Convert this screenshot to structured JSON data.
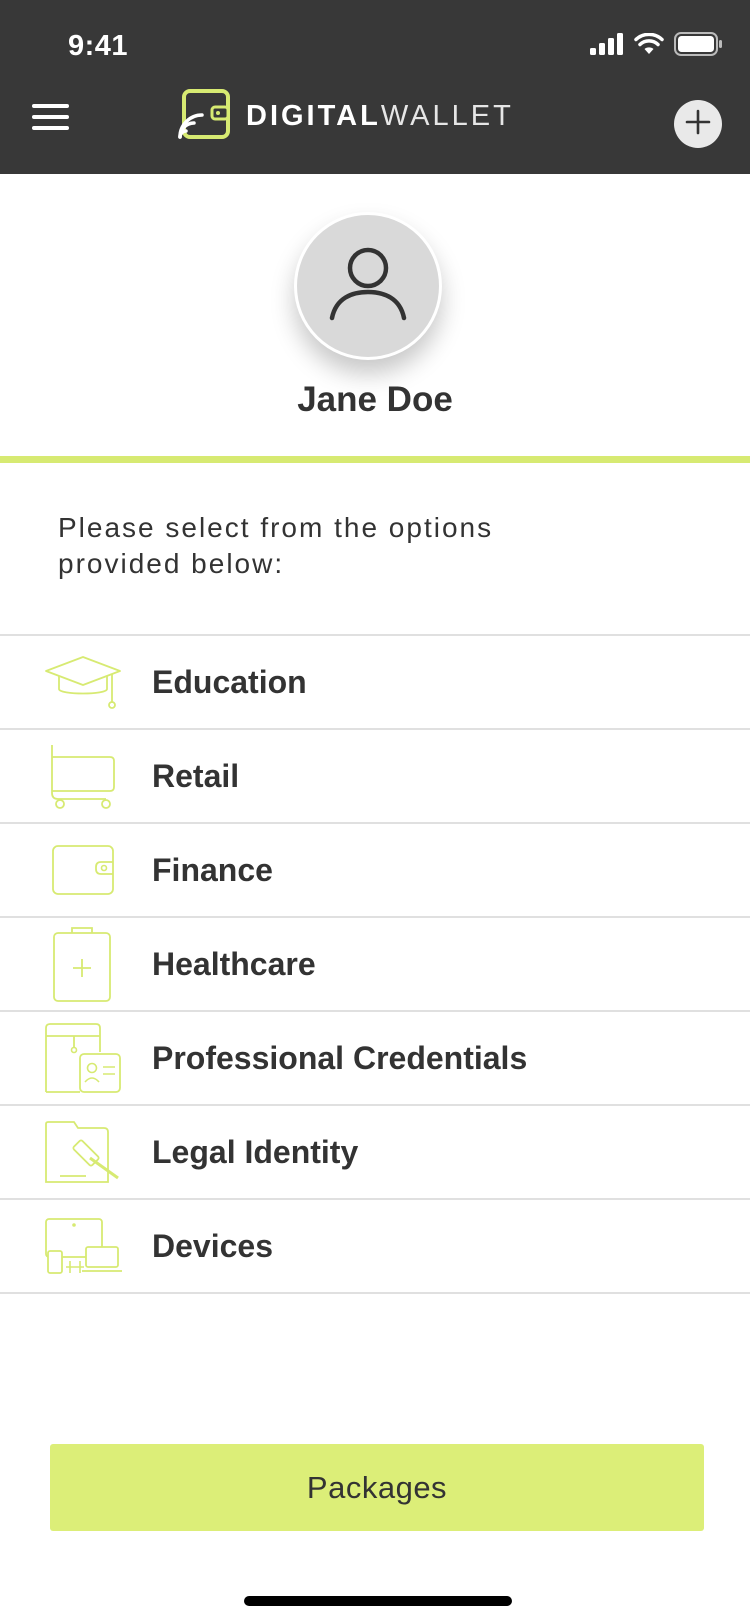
{
  "status_bar": {
    "time": "9:41"
  },
  "header": {
    "logo_bold": "DIGITAL",
    "logo_light": "WALLET",
    "menu_icon": "hamburger-icon",
    "add_icon": "plus-icon"
  },
  "profile": {
    "name": "Jane Doe",
    "avatar_icon": "user-icon"
  },
  "prompt": "Please select from the options provided below:",
  "options": [
    {
      "label": "Education",
      "icon": "graduation-cap-icon"
    },
    {
      "label": "Retail",
      "icon": "shopping-cart-icon"
    },
    {
      "label": "Finance",
      "icon": "wallet-icon"
    },
    {
      "label": "Healthcare",
      "icon": "clipboard-plus-icon"
    },
    {
      "label": "Professional Credentials",
      "icon": "id-card-folder-icon"
    },
    {
      "label": "Legal Identity",
      "icon": "gavel-folder-icon"
    },
    {
      "label": "Devices",
      "icon": "devices-icon"
    }
  ],
  "footer": {
    "packages_label": "Packages"
  },
  "colors": {
    "header_bg": "#383838",
    "accent": "#d7ea72",
    "button_bg": "#dcee78",
    "text": "#333333"
  }
}
